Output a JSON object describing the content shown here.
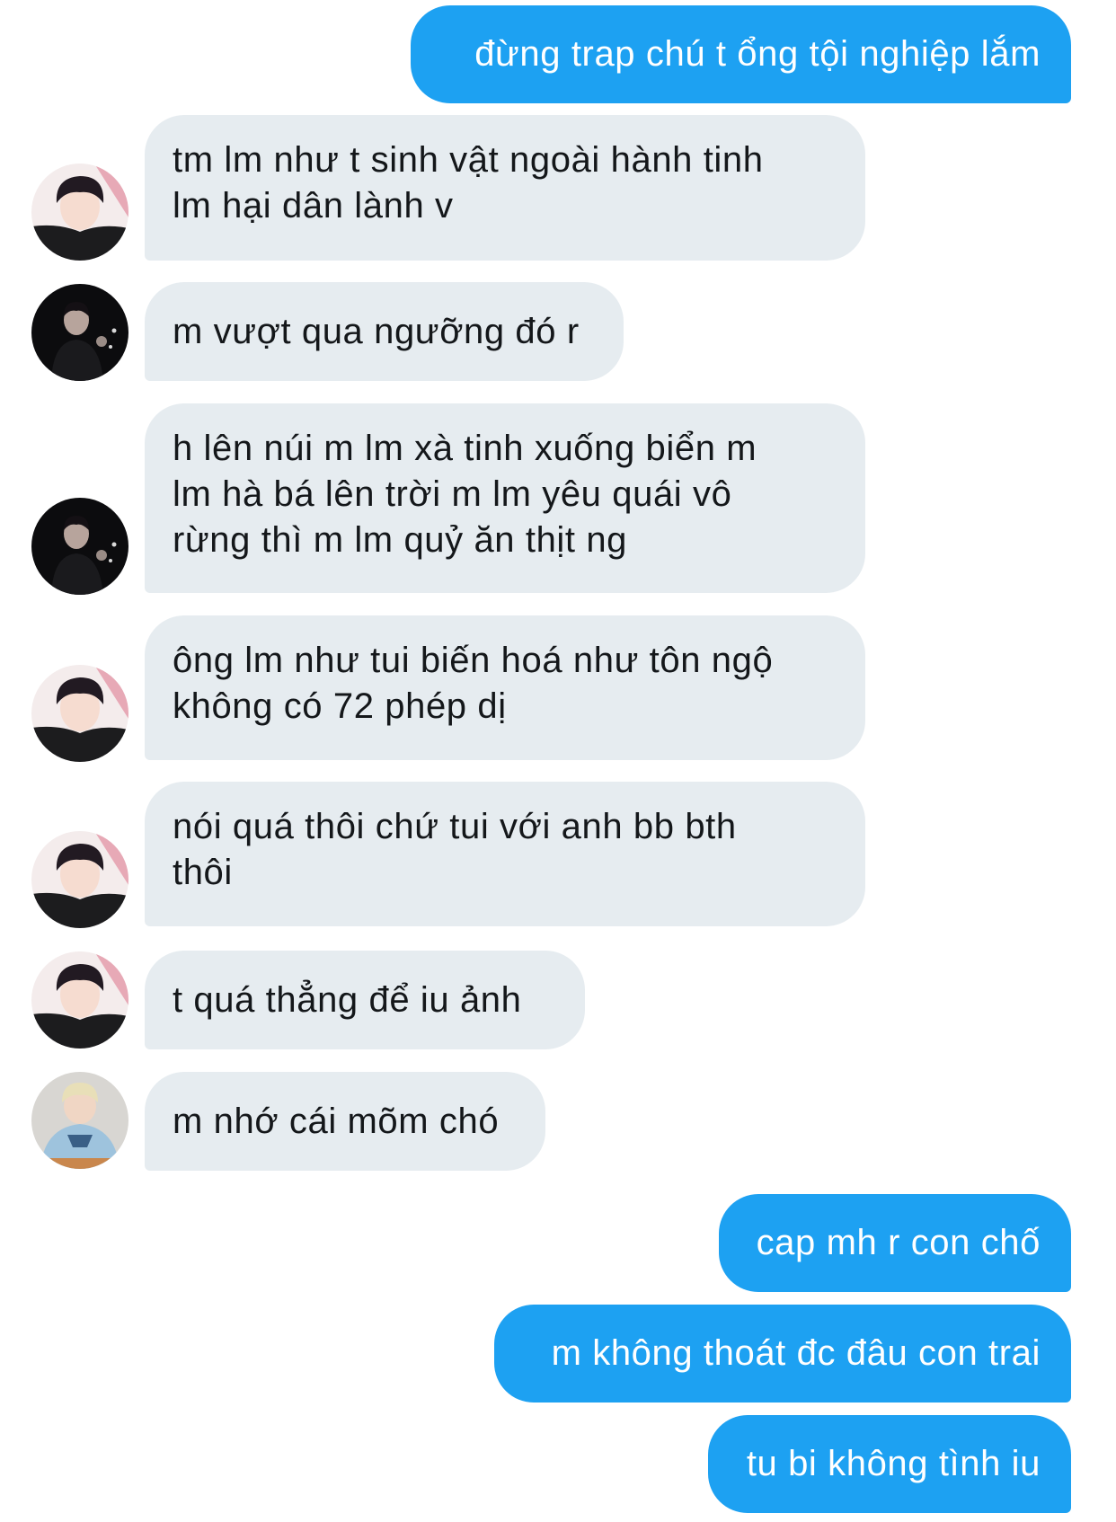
{
  "messages": [
    {
      "side": "out",
      "lines": [
        "đừng trap chú t ổng tội nghiệp lắm"
      ]
    },
    {
      "side": "in",
      "avatar": "avatar-a",
      "lines": [
        "tm lm như t sinh vật ngoài hành tinh",
        "lm hại dân lành v"
      ]
    },
    {
      "side": "in",
      "avatar": "avatar-b",
      "lines": [
        "m vượt qua ngưỡng đó r"
      ]
    },
    {
      "side": "in",
      "avatar": "avatar-b",
      "lines": [
        "h lên núi m lm xà tinh xuống biển m",
        "lm hà bá lên trời m lm yêu quái vô",
        "rừng thì m lm quỷ ăn thịt ng"
      ]
    },
    {
      "side": "in",
      "avatar": "avatar-a",
      "lines": [
        "ông lm như tui biến hoá như tôn ngộ",
        "không có 72 phép dị"
      ]
    },
    {
      "side": "in",
      "avatar": "avatar-a",
      "lines": [
        "nói quá thôi chứ tui với anh bb bth",
        "thôi"
      ]
    },
    {
      "side": "in",
      "avatar": "avatar-a",
      "lines": [
        "t quá thẳng để iu ảnh"
      ]
    },
    {
      "side": "in",
      "avatar": "avatar-c",
      "lines": [
        "m nhớ cái mõm chó"
      ]
    },
    {
      "side": "out",
      "lines": [
        "cap mh r con chố"
      ]
    },
    {
      "side": "out",
      "lines": [
        "m không thoát đc đâu con trai"
      ]
    },
    {
      "side": "out",
      "lines": [
        "tu bi không tình iu"
      ]
    }
  ],
  "colors": {
    "outgoing_bubble": "#1da1f2",
    "incoming_bubble": "#e6ecf0",
    "incoming_text": "#14171a",
    "outgoing_text": "#ffffff"
  }
}
